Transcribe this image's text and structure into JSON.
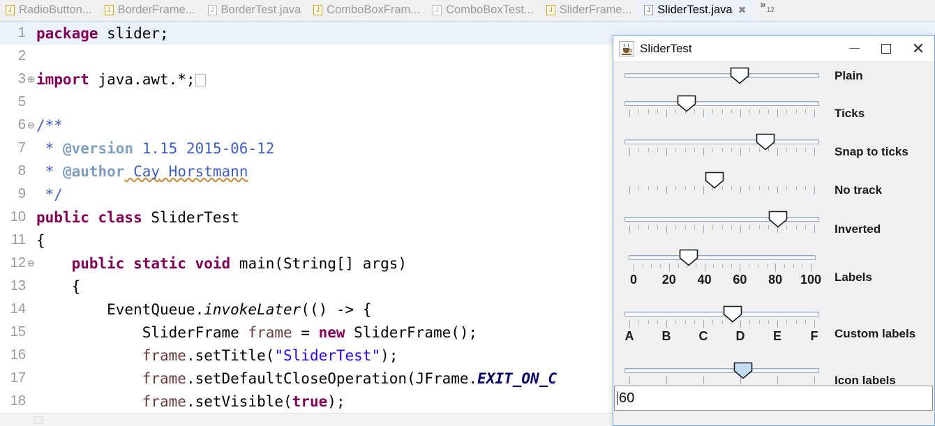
{
  "ide": {
    "tabs": [
      {
        "label": "RadioButton...",
        "icon": "java-file-icon",
        "active": false,
        "warn": false
      },
      {
        "label": "BorderFrame...",
        "icon": "java-file-warning-icon",
        "active": false,
        "warn": true
      },
      {
        "label": "BorderTest.java",
        "icon": "java-file-icon",
        "active": false,
        "warn": false
      },
      {
        "label": "ComboBoxFram...",
        "icon": "java-file-warning-icon",
        "active": false,
        "warn": true
      },
      {
        "label": "ComboBoxTest...",
        "icon": "java-file-icon",
        "active": false,
        "warn": false
      },
      {
        "label": "SliderFrame...",
        "icon": "java-file-warning-icon",
        "active": false,
        "warn": true
      },
      {
        "label": "SliderTest.java",
        "icon": "java-file-icon",
        "active": true,
        "warn": false
      }
    ],
    "active_tab_close_icon": "close-icon",
    "tab_overflow": {
      "chevron": "»",
      "count": "12"
    },
    "code_lines": [
      {
        "num": "1",
        "fold": "",
        "current": true
      },
      {
        "num": "2",
        "fold": "",
        "current": false
      },
      {
        "num": "3",
        "fold": "⊕",
        "current": false
      },
      {
        "num": "5",
        "fold": "",
        "current": false
      },
      {
        "num": "6",
        "fold": "⊖",
        "current": false
      },
      {
        "num": "7",
        "fold": "",
        "current": false
      },
      {
        "num": "8",
        "fold": "",
        "current": false
      },
      {
        "num": "9",
        "fold": "",
        "current": false
      },
      {
        "num": "10",
        "fold": "",
        "current": false
      },
      {
        "num": "11",
        "fold": "",
        "current": false
      },
      {
        "num": "12",
        "fold": "⊖",
        "current": false
      },
      {
        "num": "13",
        "fold": "",
        "current": false
      },
      {
        "num": "14",
        "fold": "",
        "current": false
      },
      {
        "num": "15",
        "fold": "",
        "current": false
      },
      {
        "num": "16",
        "fold": "",
        "current": false
      },
      {
        "num": "17",
        "fold": "",
        "current": false
      },
      {
        "num": "18",
        "fold": "",
        "current": false
      }
    ],
    "code_text": {
      "l1_kw": "package",
      "l1_rest": " slider;",
      "l3_kw": "import",
      "l3_rest": " java.awt.*;",
      "l6": "/**",
      "l7_star": " * ",
      "l7_tag": "@version",
      "l7_val": " 1.15 2015-06-12",
      "l8_star": " * ",
      "l8_tag": "@author",
      "l8_val_a": " Cay",
      "l8_val_b": " Horstmann",
      "l9": " */",
      "l10_kw1": "public",
      "l10_kw2": " class",
      "l10_name": " SliderTest",
      "l11": "{",
      "l12_kw": "    public static void",
      "l12_rest": " main(String[] args)",
      "l13": "    {",
      "l14_a": "        EventQueue.",
      "l14_m": "invokeLater",
      "l14_b": "(() -> {",
      "l15_a": "            SliderFrame ",
      "l15_v": "frame",
      "l15_eq": " = ",
      "l15_kw": "new",
      "l15_b": " SliderFrame();",
      "l16_a": "            ",
      "l16_v": "frame",
      "l16_b": ".setTitle(",
      "l16_s": "\"SliderTest\"",
      "l16_c": ");",
      "l17_a": "            ",
      "l17_v": "frame",
      "l17_b": ".setDefaultCloseOperation(JFrame.",
      "l17_s": "EXIT_ON_C",
      "l18_a": "            ",
      "l18_v": "frame",
      "l18_b": ".setVisible(",
      "l18_kw": "true",
      "l18_c": ");"
    }
  },
  "jframe": {
    "title": "SliderTest",
    "app_icon": "java-coffee-cup-icon",
    "window_buttons": [
      {
        "name": "minimize-button",
        "icon": "minimize-icon"
      },
      {
        "name": "maximize-button",
        "icon": "maximize-icon"
      },
      {
        "name": "close-button",
        "icon": "close-icon"
      }
    ],
    "sliders": [
      {
        "name": "plain",
        "label": "Plain",
        "value": 60,
        "min": 0,
        "max": 100,
        "inverted": false,
        "track_visible": true,
        "ticks": false,
        "major_tick_spacing": 20,
        "minor_tick_spacing": 5,
        "tick_labels": [],
        "focused": false
      },
      {
        "name": "ticks",
        "label": "Ticks",
        "value": 30,
        "min": 0,
        "max": 100,
        "inverted": false,
        "track_visible": true,
        "ticks": true,
        "major_tick_spacing": 20,
        "minor_tick_spacing": 5,
        "tick_labels": [],
        "focused": false
      },
      {
        "name": "snap-to-ticks",
        "label": "Snap to ticks",
        "value": 75,
        "min": 0,
        "max": 100,
        "inverted": false,
        "track_visible": true,
        "ticks": true,
        "major_tick_spacing": 20,
        "minor_tick_spacing": 5,
        "tick_labels": [],
        "focused": false
      },
      {
        "name": "no-track",
        "label": "No track",
        "value": 46,
        "min": 0,
        "max": 100,
        "inverted": false,
        "track_visible": false,
        "ticks": true,
        "major_tick_spacing": 20,
        "minor_tick_spacing": 5,
        "tick_labels": [],
        "focused": false
      },
      {
        "name": "inverted",
        "label": "Inverted",
        "value": 18,
        "min": 0,
        "max": 100,
        "inverted": true,
        "track_visible": true,
        "ticks": true,
        "major_tick_spacing": 20,
        "minor_tick_spacing": 5,
        "tick_labels": [],
        "focused": false
      },
      {
        "name": "labels",
        "label": "Labels",
        "value": 30,
        "min": 0,
        "max": 100,
        "inverted": false,
        "track_visible": true,
        "ticks": true,
        "major_tick_spacing": 20,
        "minor_tick_spacing": 5,
        "tick_labels": [
          "0",
          "20",
          "40",
          "60",
          "80",
          "100"
        ],
        "focused": false
      },
      {
        "name": "custom-labels",
        "label": "Custom labels",
        "value": 56,
        "min": 0,
        "max": 100,
        "inverted": false,
        "track_visible": true,
        "ticks": true,
        "major_tick_spacing": 20,
        "minor_tick_spacing": 5,
        "tick_labels": [
          "A",
          "B",
          "C",
          "D",
          "E",
          "F"
        ],
        "focused": false
      },
      {
        "name": "icon-labels",
        "label": "Icon labels",
        "value": 62,
        "min": 0,
        "max": 100,
        "inverted": false,
        "track_visible": true,
        "ticks": true,
        "major_tick_spacing": 20,
        "minor_tick_spacing": 20,
        "tick_labels": [],
        "focused": true
      }
    ],
    "value_field": {
      "value": "60",
      "placeholder": ""
    }
  },
  "colors": {
    "window_border": "#6fa8dc",
    "panel_bg": "#f0f0f0",
    "active_tab_bg": "#eaf1fb",
    "current_line_bg": "#eaf1fb",
    "keyword": "#7f0055",
    "string": "#2a00ff",
    "javadoc": "#3f5fbf",
    "javadoc_tag": "#7f9fbf",
    "focus_thumb": "#cfe2f5"
  }
}
